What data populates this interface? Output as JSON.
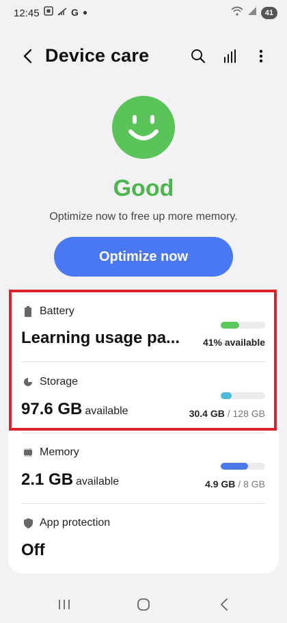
{
  "status_bar": {
    "time": "12:45",
    "g_label": "G",
    "battery_level": "41"
  },
  "header": {
    "title": "Device care"
  },
  "summary": {
    "status": "Good",
    "message": "Optimize now to free up more memory.",
    "button_label": "Optimize now"
  },
  "battery": {
    "label": "Battery",
    "value": "Learning usage pa...",
    "detail": "41% available",
    "level_percent": 41,
    "bar_color": "#5bc85b"
  },
  "storage": {
    "label": "Storage",
    "value": "97.6 GB",
    "unit": "available",
    "used": "30.4 GB",
    "separator": "/",
    "total": "128 GB",
    "used_fraction": 0.24,
    "bar_color": "#4fbad8"
  },
  "memory": {
    "label": "Memory",
    "value": "2.1 GB",
    "unit": "available",
    "used": "4.9 GB",
    "separator": "/",
    "total": "8 GB",
    "used_fraction": 0.61,
    "bar_color": "#4a78e6"
  },
  "app_protection": {
    "label": "App protection",
    "value": "Off"
  },
  "colors": {
    "accent": "#4a78f2",
    "good": "#4cb64c",
    "highlight": "#d8222c"
  }
}
